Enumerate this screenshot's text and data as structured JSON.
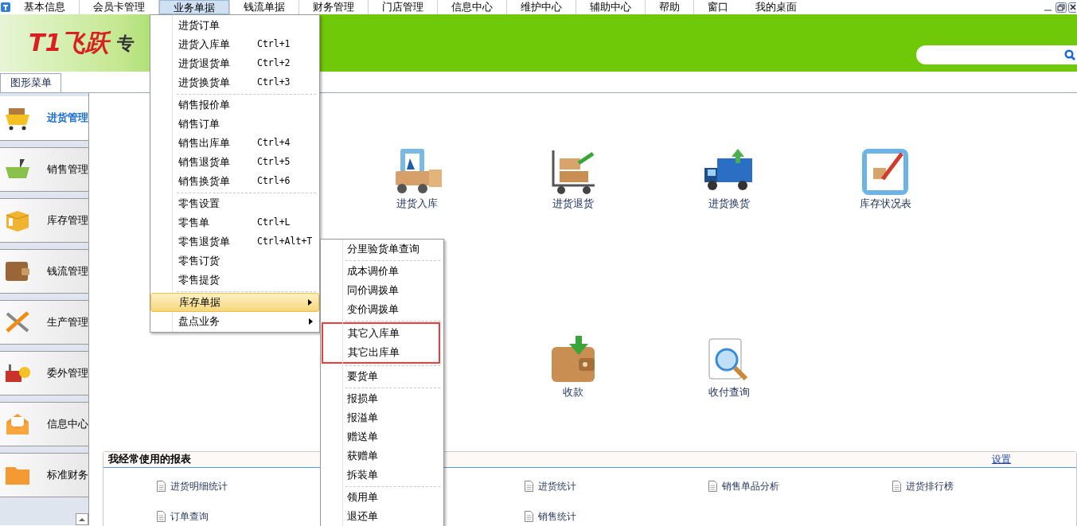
{
  "menubar": [
    {
      "label": "基本信息",
      "selected": false
    },
    {
      "label": "会员卡管理",
      "selected": false
    },
    {
      "label": "业务单据",
      "selected": true
    },
    {
      "label": "钱流单据",
      "selected": false
    },
    {
      "label": "财务管理",
      "selected": false
    },
    {
      "label": "门店管理",
      "selected": false
    },
    {
      "label": "信息中心",
      "selected": false
    },
    {
      "label": "维护中心",
      "selected": false
    },
    {
      "label": "辅助中心",
      "selected": false
    },
    {
      "label": "帮助",
      "selected": false
    },
    {
      "label": "窗口",
      "selected": false
    },
    {
      "label": "我的桌面",
      "selected": false
    }
  ],
  "banner": {
    "logo": "T1飞跃",
    "slogan": "专"
  },
  "tabs": [
    {
      "label": "图形菜单",
      "selected": true
    }
  ],
  "sidebar": [
    {
      "label": "进货管理",
      "selected": true
    },
    {
      "label": "销售管理",
      "selected": false
    },
    {
      "label": "库存管理",
      "selected": false
    },
    {
      "label": "钱流管理",
      "selected": false
    },
    {
      "label": "生产管理",
      "selected": false
    },
    {
      "label": "委外管理",
      "selected": false
    },
    {
      "label": "信息中心",
      "selected": false
    },
    {
      "label": "标准财务",
      "selected": false
    }
  ],
  "shortcuts": [
    [
      "进货入库",
      "进货退货",
      "进货换货",
      "库存状况表"
    ],
    [
      "收款",
      "收付查询"
    ]
  ],
  "reports": {
    "title": "我经常使用的报表",
    "settings_link": "设置",
    "rows": [
      [
        "进货明细统计",
        null,
        "进货统计",
        "销售单品分析",
        "进货排行榜"
      ],
      [
        "订单查询",
        null,
        "销售统计"
      ]
    ]
  },
  "dropdown": {
    "groups": [
      [
        {
          "label": "进货订单",
          "has_submenu": false,
          "selected": false
        },
        {
          "label": "进货入库单",
          "shortcut": "Ctrl+1",
          "has_submenu": false,
          "selected": false
        },
        {
          "label": "进货退货单",
          "shortcut": "Ctrl+2",
          "has_submenu": false,
          "selected": false
        },
        {
          "label": "进货换货单",
          "shortcut": "Ctrl+3",
          "has_submenu": false,
          "selected": false
        }
      ],
      [
        {
          "label": "销售报价单",
          "has_submenu": false,
          "selected": false
        },
        {
          "label": "销售订单",
          "has_submenu": false,
          "selected": false
        },
        {
          "label": "销售出库单",
          "shortcut": "Ctrl+4",
          "has_submenu": false,
          "selected": false
        },
        {
          "label": "销售退货单",
          "shortcut": "Ctrl+5",
          "has_submenu": false,
          "selected": false
        },
        {
          "label": "销售换货单",
          "shortcut": "Ctrl+6",
          "has_submenu": false,
          "selected": false
        }
      ],
      [
        {
          "label": "零售设置",
          "has_submenu": false,
          "selected": false
        },
        {
          "label": "零售单",
          "shortcut": "Ctrl+L",
          "has_submenu": false,
          "selected": false
        },
        {
          "label": "零售退货单",
          "shortcut": "Ctrl+Alt+T",
          "has_submenu": false,
          "selected": false
        },
        {
          "label": "零售订货",
          "has_submenu": false,
          "selected": false
        },
        {
          "label": "零售提货",
          "has_submenu": false,
          "selected": false
        }
      ],
      [
        {
          "label": "库存单据",
          "has_submenu": true,
          "selected": true
        },
        {
          "label": "盘点业务",
          "has_submenu": true,
          "selected": false
        }
      ]
    ]
  },
  "submenu": {
    "groups": [
      {
        "highlighted": false,
        "items": [
          "分里验货单查询"
        ]
      },
      {
        "highlighted": false,
        "items": [
          "成本调价单",
          "同价调拨单",
          "变价调拨单"
        ]
      },
      {
        "highlighted": true,
        "items": [
          "其它入库单",
          "其它出库单"
        ]
      },
      {
        "highlighted": false,
        "items": [
          "要货单"
        ]
      },
      {
        "highlighted": false,
        "items": [
          "报损单",
          "报溢单",
          "赠送单",
          "获赠单",
          "拆装单"
        ]
      },
      {
        "highlighted": false,
        "items": [
          "领用单",
          "退还单"
        ]
      }
    ]
  }
}
